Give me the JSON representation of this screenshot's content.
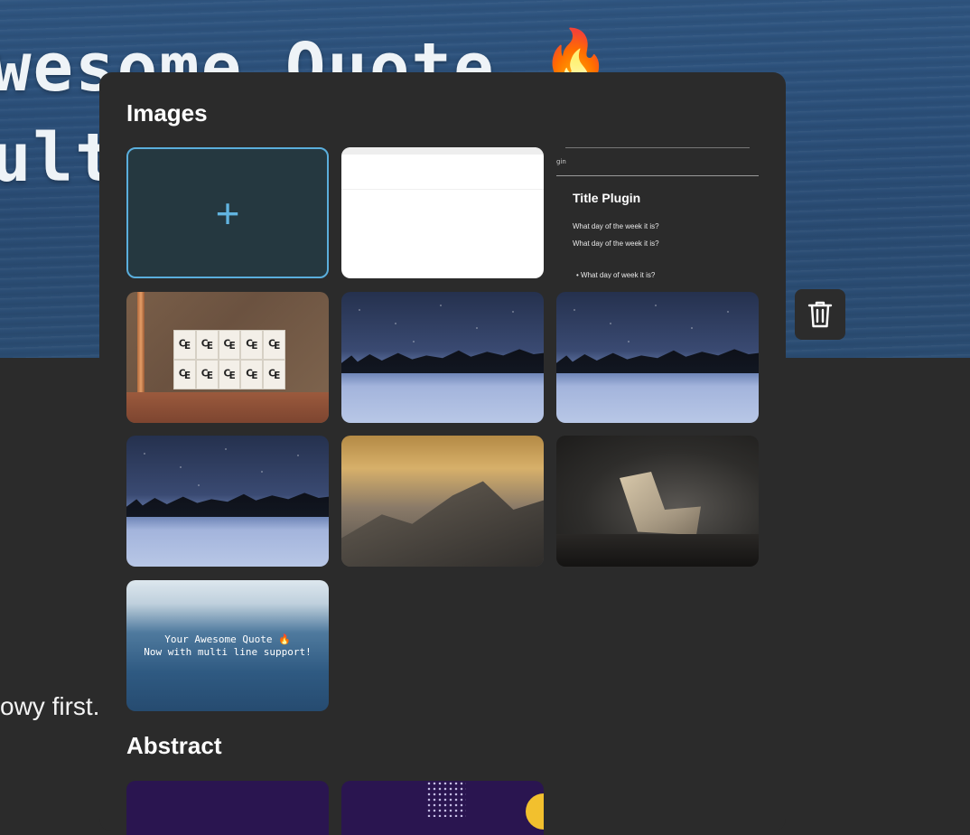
{
  "background": {
    "hero_line1": "wesome Quote",
    "hero_flame": "🔥",
    "hero_line2": "ult",
    "side_text": "owy first."
  },
  "panel": {
    "images_title": "Images",
    "abstract_title": "Abstract",
    "add_tile_icon": "+",
    "doc_preview": {
      "tiny_label": "gin",
      "title": "Title Plugin",
      "line1": "What day of the week it is?",
      "line2": "What day of the week it is?",
      "bullet": "What day of week it is?"
    },
    "stamps_glyph": "₠",
    "quote_preview": {
      "line1": "Your Awesome Quote 🔥",
      "line2": "Now with multi line support!"
    }
  },
  "actions": {
    "delete_icon": "trash-icon"
  },
  "colors": {
    "panel_bg": "#2b2b2b",
    "accent": "#5aaedc",
    "add_tile_bg": "#253840"
  }
}
